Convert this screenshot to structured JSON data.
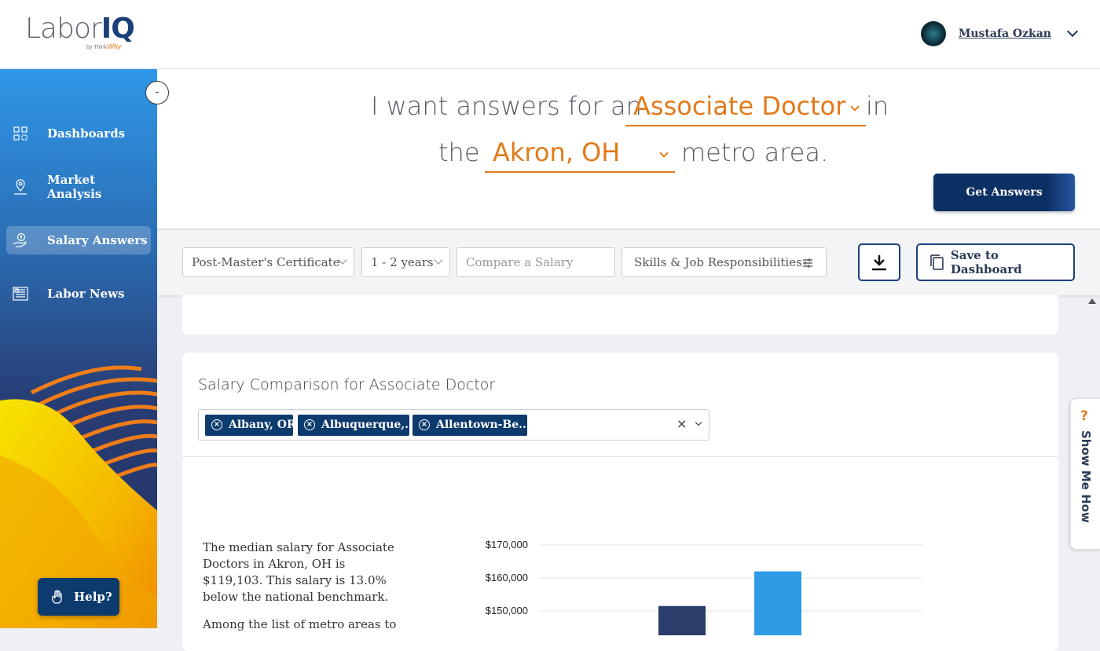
{
  "app": {
    "logo_text": "Labor",
    "logo_accent": "IQ",
    "logo_by": "by Think",
    "logo_brand": "Why"
  },
  "user": {
    "name": "Mustafa Ozkan"
  },
  "sidebar": {
    "collapse_label": "-",
    "items": [
      {
        "label": "Dashboards",
        "icon": "grid-icon",
        "active": false
      },
      {
        "label": "Market Analysis",
        "icon": "map-pin-icon",
        "active": false
      },
      {
        "label": "Salary Answers",
        "icon": "salary-hand-icon",
        "active": true
      },
      {
        "label": "Labor News",
        "icon": "newspaper-icon",
        "active": false
      }
    ],
    "help_label": "Help?"
  },
  "query": {
    "prefix": "I want answers for an",
    "job": "Associate Doctor",
    "middle": "in",
    "the": "the",
    "location": "Akron, OH",
    "suffix": "metro area.",
    "button": "Get Answers"
  },
  "filters": {
    "education": "Post-Master's Certificate",
    "experience": "1 - 2 years",
    "compare_placeholder": "Compare a Salary",
    "skills": "Skills & Job Responsibilities",
    "save_label": "Save to Dashboard"
  },
  "comparison": {
    "title": "Salary Comparison for Associate Doctor",
    "tags": [
      "Albany, OR",
      "Albuquerque,...",
      "Allentown-Be..."
    ],
    "clear_label": "×",
    "description_1": "The median salary for Associate Doctors in Akron, OH is $119,103. This salary is 13.0% below the national benchmark.",
    "description_2": "Among the list of metro areas to"
  },
  "chart_data": {
    "type": "bar",
    "y_ticks": [
      "$170,000",
      "$160,000",
      "$150,000"
    ],
    "ylim_visible": [
      147000,
      170000
    ],
    "bars": [
      {
        "value": 151500,
        "color": "#2b3d6b"
      },
      {
        "value": 162000,
        "color": "#2f9be6"
      }
    ]
  },
  "show_me_how": {
    "icon": "?",
    "label": "Show Me How"
  }
}
